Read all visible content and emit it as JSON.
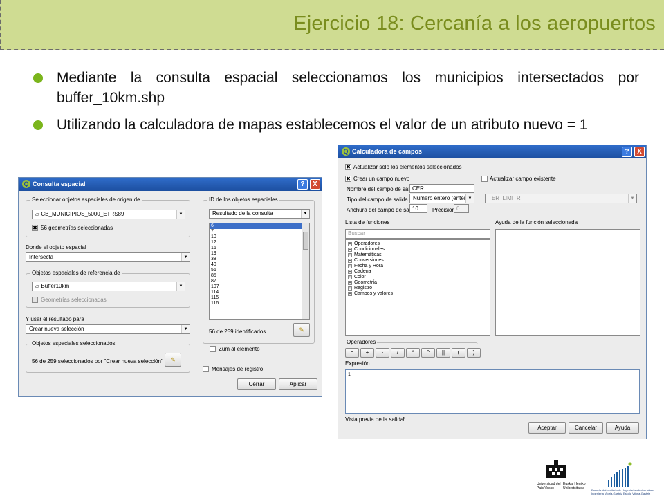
{
  "slide": {
    "title": "Ejercicio 18: Cercanía a los aeropuertos",
    "bullets": [
      "Mediante la consulta espacial seleccionamos los municipios intersectados por buffer_10km.shp",
      "Utilizando la calculadora de mapas establecemos el valor de un atributo nuevo = 1"
    ],
    "accent_color": "#7bb51c",
    "banner_color": "#cfdc92"
  },
  "consulta": {
    "title": "Consulta espacial",
    "help_label": "?",
    "close_label": "X",
    "origin_group": "Seleccionar objetos espaciales de origen de",
    "origin_layer": "CB_MUNICIPIOS_5000_ETRS89",
    "origin_selected": "56 geometrías seleccionadas",
    "where_label": "Donde el objeto espacial",
    "where_value": "Intersecta",
    "ref_group": "Objetos espaciales de referencia de",
    "ref_layer": "Buffer10km",
    "ref_selected": "Geometrías seleccionadas",
    "use_label": "Y usar el resultado para",
    "use_value": "Crear nueva selección",
    "selected_group": "Objetos espaciales seleccionados",
    "selected_text": "56 de 259 seleccionados por \"Crear nueva selección\"",
    "ids_group": "ID de los objetos espaciales",
    "ids_combo": "Resultado de la consulta",
    "ids": [
      "6",
      "7",
      "10",
      "12",
      "16",
      "19",
      "38",
      "40",
      "56",
      "85",
      "87",
      "107",
      "114",
      "115",
      "116"
    ],
    "identified": "56 de 259 identificados",
    "zoom_label": "Zum al elemento",
    "log_label": "Mensajes de registro",
    "close_button": "Cerrar",
    "apply_button": "Aplicar"
  },
  "calc": {
    "title": "Calculadora de campos",
    "help_label": "?",
    "close_label": "X",
    "update_selected": "Actualizar sólo los elementos seleccionados",
    "new_field": "Crear un campo nuevo",
    "update_existing": "Actualizar campo existente",
    "field_name_label": "Nombre del campo de salida",
    "field_name": "CER",
    "field_type_label": "Tipo del campo de salida",
    "field_type": "Número entero (entero)",
    "width_label": "Anchura del campo de salida",
    "width": "10",
    "precision_label": "Precisión",
    "precision": "0",
    "existing_field": "TER_LIMITR",
    "functions_label": "Lista de funciones",
    "search_placeholder": "Buscar",
    "functions": [
      "Operadores",
      "Condicionales",
      "Matemáticas",
      "Conversiones",
      "Fecha y Hora",
      "Cadena",
      "Color",
      "Geometría",
      "Registro",
      "Campos y valores"
    ],
    "help_panel_label": "Ayuda de la función seleccionada",
    "operators_label": "Operadores",
    "operators": [
      "=",
      "+",
      "-",
      "/",
      "*",
      "^",
      "||",
      "(",
      ")"
    ],
    "expression_label": "Expresión",
    "expression": "1",
    "preview_label": "Vista previa de la salida:",
    "preview_value": "1",
    "accept_button": "Aceptar",
    "cancel_button": "Cancelar",
    "help_button": "Ayuda"
  },
  "logos": {
    "ehu_left": "Universidad del País Vasco",
    "ehu_right": "Euskal Herriko Unibertsitatea",
    "esc_left": "Escuela Universitaria de Ingeniería Vitoria-Gasteiz",
    "esc_right": "Ingeniaritza Unibertsitate Eskola Vitoria-Gasteiz"
  }
}
